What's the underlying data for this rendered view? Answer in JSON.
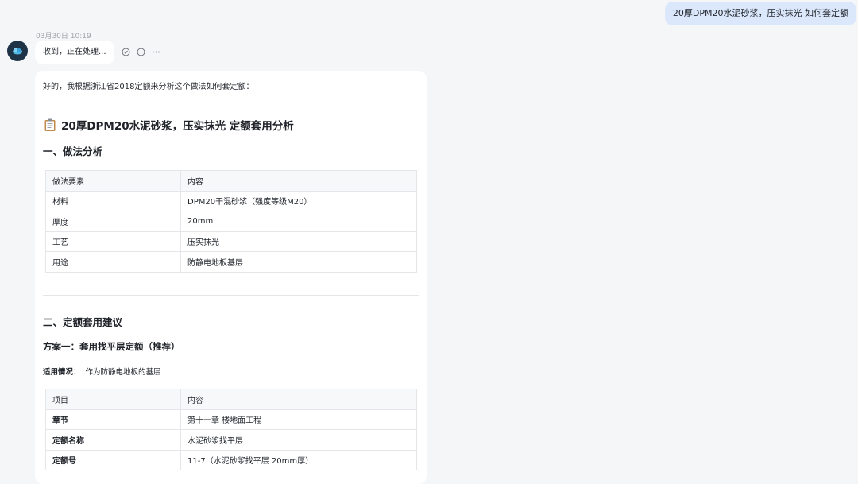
{
  "user_message": "20厚DPM20水泥砂浆，压实抹光 如何套定额",
  "timestamp": "03月30日 10:19",
  "assistant_status": "收到，正在处理...",
  "answer": {
    "intro": "好的，我根据浙江省2018定额来分析这个做法如何套定额：",
    "main_icon": "clipboard-icon",
    "main_title": "20厚DPM20水泥砂浆，压实抹光 定额套用分析",
    "section1_title": "一、做法分析",
    "table1": {
      "headers": [
        "做法要素",
        "内容"
      ],
      "rows": [
        [
          "材料",
          "DPM20干混砂浆（强度等级M20）"
        ],
        [
          "厚度",
          "20mm"
        ],
        [
          "工艺",
          "压实抹光"
        ],
        [
          "用途",
          "防静电地板基层"
        ]
      ]
    },
    "section2_title": "二、定额套用建议",
    "plan1_title": "方案一：套用找平层定额（推荐）",
    "applicable_label": "适用情况：",
    "applicable_value": "作为防静电地板的基层",
    "table2": {
      "headers": [
        "项目",
        "内容"
      ],
      "rows": [
        [
          "章节",
          "第十一章 楼地面工程"
        ],
        [
          "定额名称",
          "水泥砂浆找平层"
        ],
        [
          "定额号",
          "11-7（水泥砂浆找平层 20mm厚）"
        ]
      ]
    }
  }
}
